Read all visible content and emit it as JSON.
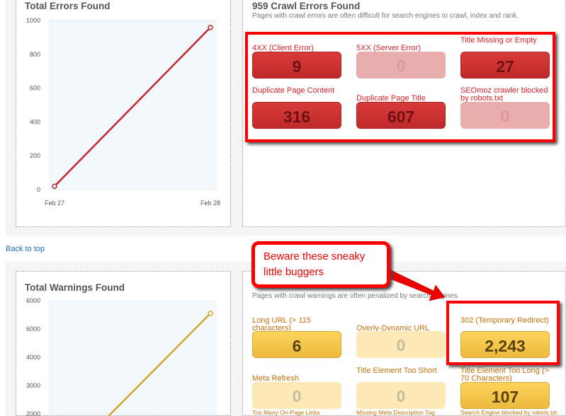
{
  "errors_chart": {
    "title": "Total Errors Found"
  },
  "errors": {
    "title": "959 Crawl Errors Found",
    "subtitle": "Pages with crawl errors are often difficult for search engines to crawl, index and rank.",
    "items": [
      {
        "label": "4XX (Client Error)",
        "value": "9"
      },
      {
        "label": "5XX (Server Error)",
        "value": "0"
      },
      {
        "label": "Title Missing or Empty",
        "value": "27"
      },
      {
        "label": "Duplicate Page Content",
        "value": "316"
      },
      {
        "label": "Duplicate Page Title",
        "value": "607"
      },
      {
        "label": "SEOmoz crawler blocked by robots.txt",
        "value": "0"
      }
    ]
  },
  "back_to_top": "Back to top",
  "callout": "Beware these sneaky little buggers",
  "warnings_chart": {
    "title": "Total Warnings Found"
  },
  "warnings": {
    "subtitle": "Pages with crawl warnings are often penalized by search engines.",
    "items": [
      {
        "label": "Long URL (> 115 characters)",
        "value": "6"
      },
      {
        "label": "Overly-Dynamic URL",
        "value": "0"
      },
      {
        "label": "302 (Temporary Redirect)",
        "value": "2,243"
      },
      {
        "label": "Meta Refresh",
        "value": "0"
      },
      {
        "label": "Title Element Too Short",
        "value": "0"
      },
      {
        "label": "Title Element Too Long (> 70 Characters)",
        "value": "107"
      },
      {
        "label": "Too Many On-Page Links",
        "value": ""
      },
      {
        "label": "Missing Meta Description Tag",
        "value": ""
      },
      {
        "label": "Search Engine blocked by robots.txt",
        "value": ""
      }
    ]
  },
  "colors": {
    "error": "#d8202a",
    "warning": "#f5c94a",
    "annotation": "#ff0000",
    "errors_line": "#c0282e",
    "warnings_line": "#d4a52e"
  },
  "chart_data": [
    {
      "type": "line",
      "title": "Total Errors Found",
      "categories": [
        "Feb 27",
        "Feb 28"
      ],
      "values": [
        20,
        959
      ],
      "ylim": [
        0,
        1000
      ],
      "yticks": [
        0,
        200,
        400,
        600,
        800,
        1000
      ],
      "grid": false
    },
    {
      "type": "line",
      "title": "Total Warnings Found",
      "categories": [
        "Feb 27",
        "Feb 28"
      ],
      "values": [
        null,
        5550
      ],
      "ylim": [
        2000,
        6000
      ],
      "yticks": [
        2000,
        3000,
        4000,
        5000,
        6000
      ],
      "ytick_labels": [
        "2000",
        "3000",
        "4000",
        "6000",
        "6000"
      ],
      "grid": false
    }
  ]
}
